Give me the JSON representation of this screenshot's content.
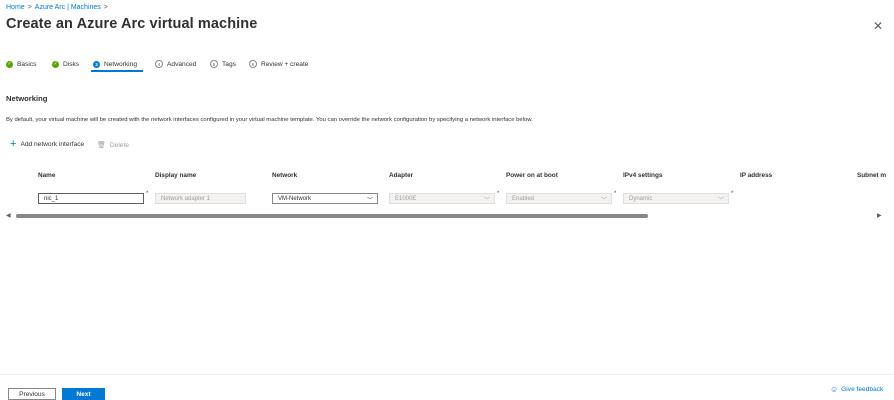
{
  "breadcrumb": {
    "home": "Home",
    "sep": ">",
    "parent": "Azure Arc | Machines",
    "sep2": ">"
  },
  "header": {
    "title": "Create an Azure Arc virtual machine",
    "more": "...",
    "close": "✕"
  },
  "tabs": [
    {
      "label": "Basics",
      "state": "done",
      "icon": "✓"
    },
    {
      "label": "Disks",
      "state": "done",
      "icon": "✓"
    },
    {
      "label": "Networking",
      "state": "active",
      "icon": "3"
    },
    {
      "label": "Advanced",
      "state": "todo",
      "icon": "4"
    },
    {
      "label": "Tags",
      "state": "todo",
      "icon": "5"
    },
    {
      "label": "Review + create",
      "state": "todo",
      "icon": "6"
    }
  ],
  "section": {
    "title": "Networking",
    "description": "By default, your virtual machine will be created with the network interfaces configured in your virtual machine template. You can override the network configuration by specifying a network interface below."
  },
  "toolbar": {
    "add_label": "Add network interface",
    "delete_label": "Delete"
  },
  "grid": {
    "columns": [
      "Name",
      "Display name",
      "Network",
      "Adapter",
      "Power on at boot",
      "IPv4 settings",
      "IP address",
      "Subnet m"
    ],
    "row": {
      "name": "nic_1",
      "display_name_placeholder": "Network adapter 1",
      "network": "VM-Network",
      "adapter": "E1000E",
      "power_on_boot": "Enabled",
      "ipv4": "Dynamic"
    },
    "required_marker": "*"
  },
  "footer": {
    "previous": "Previous",
    "next": "Next",
    "feedback": "Give feedback"
  },
  "colors": {
    "accent": "#0078d4",
    "success": "#57a300",
    "required": "#a4262c"
  }
}
